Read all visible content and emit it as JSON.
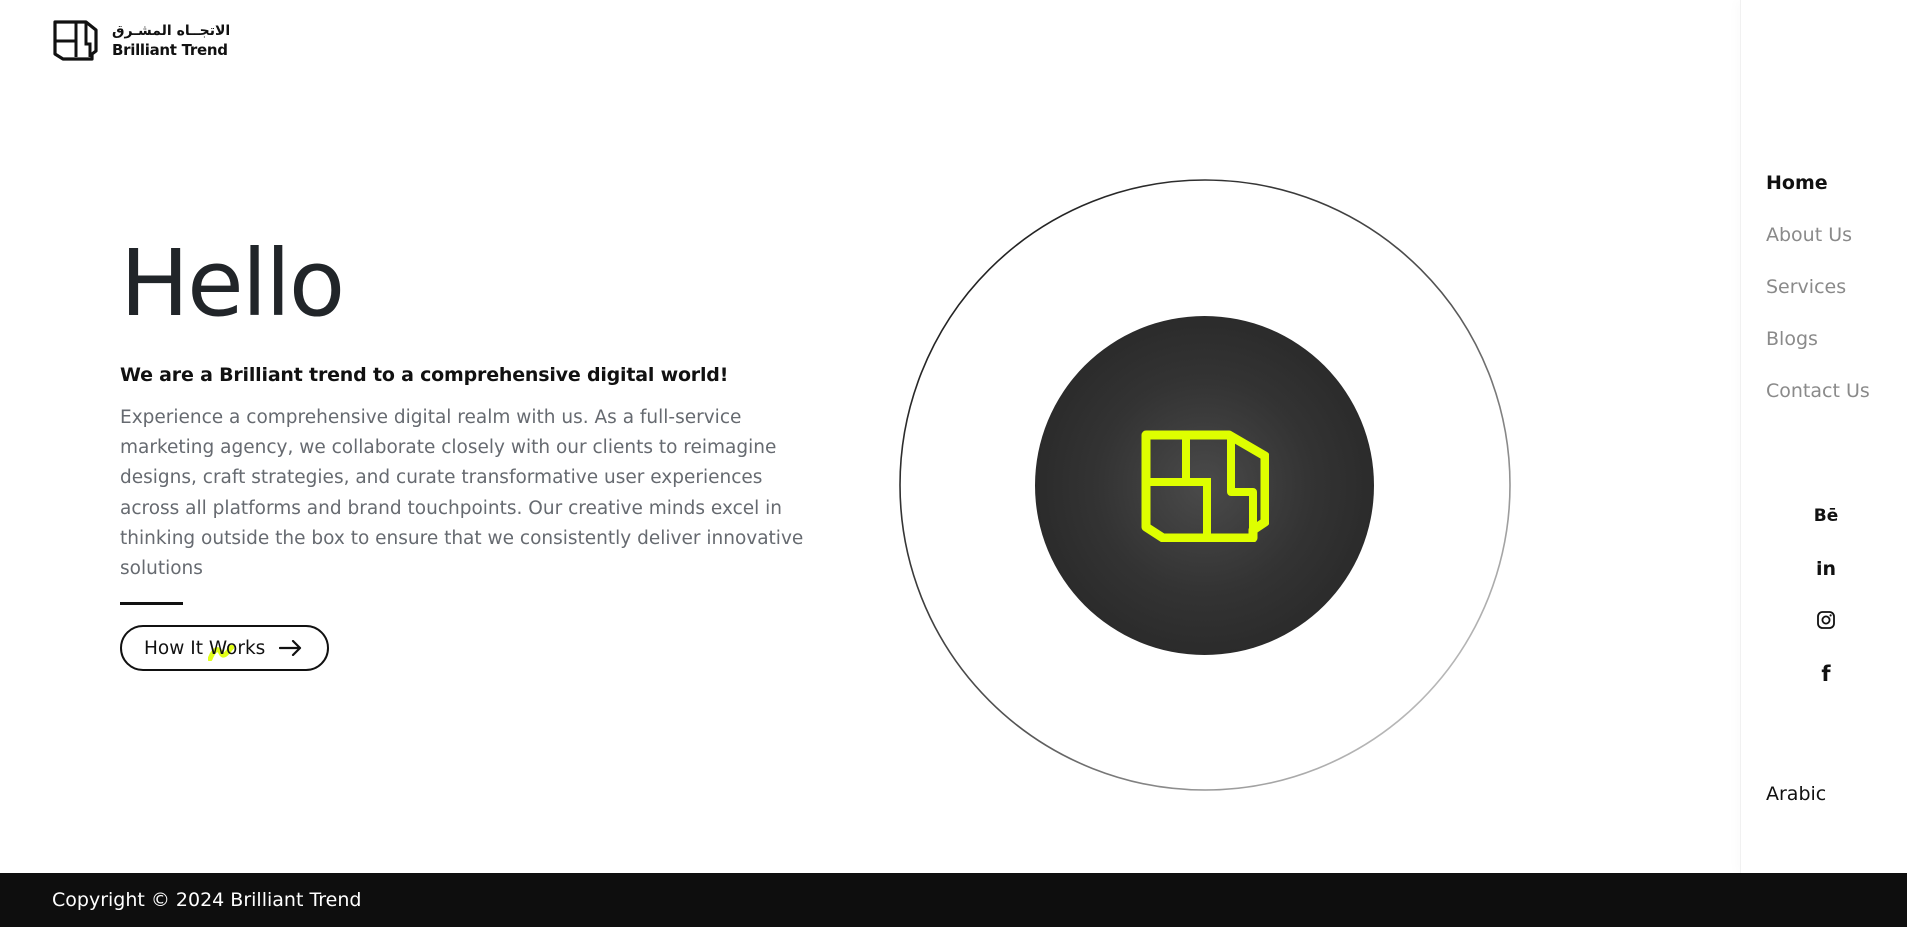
{
  "brand": {
    "arabic_name": "الاتجــاه المشـرق",
    "english_name": "Brilliant Trend",
    "logo_icon": "brilliant-trend-logo-mark",
    "accent_color": "#deff00",
    "dark_color": "#111111"
  },
  "hero": {
    "title": "Hello",
    "subtitle": "We are a Brilliant trend to a comprehensive digital world!",
    "description": "Experience a comprehensive digital realm with us. As a full-service marketing agency, we collaborate closely with our clients to reimagine designs, craft strategies, and curate transformative user experiences across all platforms and brand touchpoints. Our creative minds excel in thinking outside the box to ensure that we consistently deliver innovative solutions",
    "cta_label": "How It Works",
    "cta_icon": "arrow-right-icon"
  },
  "nav": {
    "items": [
      {
        "label": "Home",
        "active": true
      },
      {
        "label": "About Us",
        "active": false
      },
      {
        "label": "Services",
        "active": false
      },
      {
        "label": "Blogs",
        "active": false
      },
      {
        "label": "Contact Us",
        "active": false
      }
    ],
    "socials": [
      {
        "name": "behance-icon",
        "glyph": "Bē"
      },
      {
        "name": "linkedin-icon",
        "glyph": "in"
      },
      {
        "name": "instagram-icon",
        "glyph": ""
      },
      {
        "name": "facebook-icon",
        "glyph": "f"
      }
    ],
    "language_switch": "Arabic"
  },
  "footer": {
    "copyright": "Copyright © 2024 Brilliant Trend"
  }
}
